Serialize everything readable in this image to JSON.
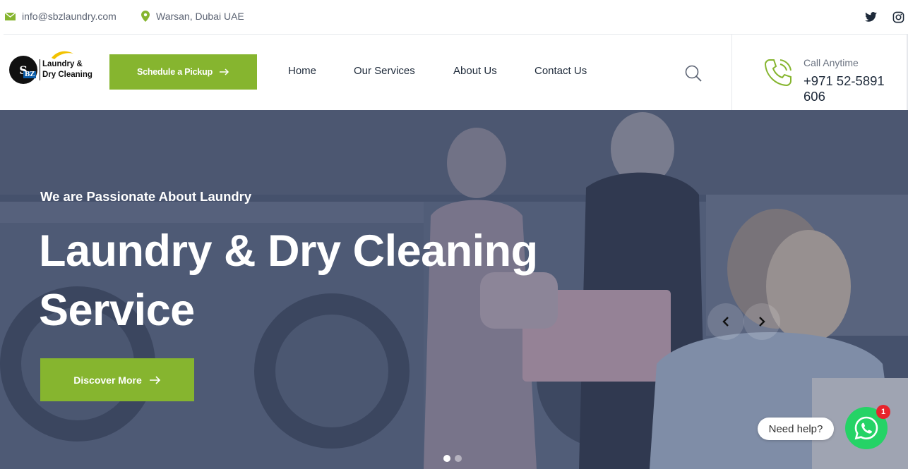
{
  "topbar": {
    "email": "info@sbzlaundry.com",
    "location": "Warsan, Dubai UAE",
    "social": [
      "twitter-icon",
      "instagram-icon"
    ]
  },
  "header": {
    "logo": {
      "mark": "S",
      "mark_sub": "BZ",
      "line1": "Laundry &",
      "line2": "Dry Cleaning"
    },
    "schedule_button": "Schedule a Pickup",
    "nav": [
      "Home",
      "Our Services",
      "About Us",
      "Contact Us"
    ],
    "call_label": "Call Anytime",
    "call_number": "+971 52-5891 606"
  },
  "hero": {
    "subtitle": "We are Passionate About Laundry",
    "title": "Laundry & Dry Cleaning Service",
    "cta": "Discover More",
    "slides_total": 2,
    "active_slide": 1
  },
  "chat": {
    "prompt": "Need help?",
    "badge": "1"
  },
  "colors": {
    "accent": "#86b52f",
    "text": "#1e2a3a",
    "muted": "#5a6272",
    "whatsapp": "#25d366",
    "badge": "#e8232c",
    "hero_overlay": "#4a5770"
  }
}
